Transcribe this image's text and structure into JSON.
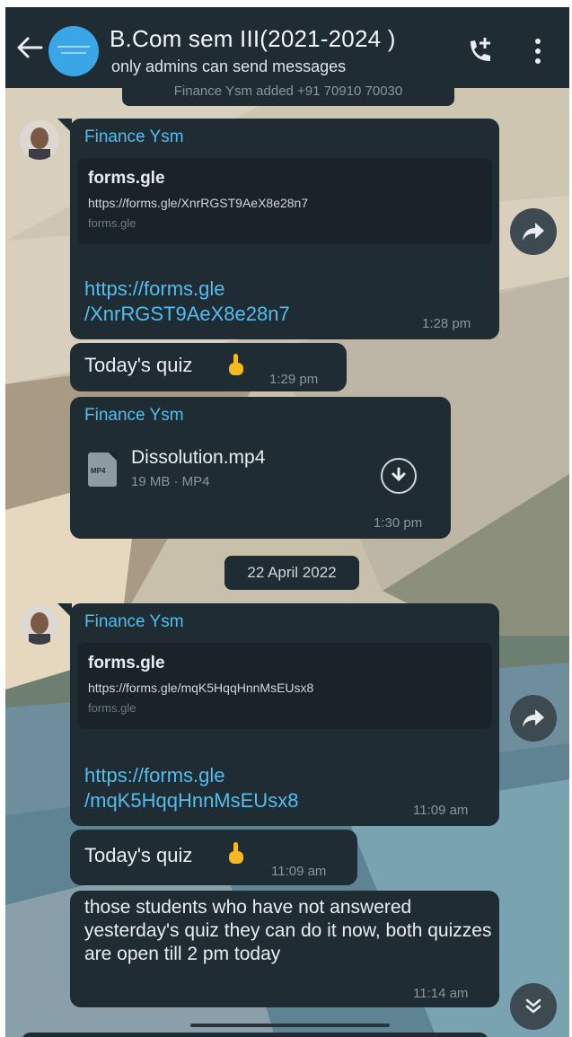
{
  "header": {
    "title": "B.Com sem III(2021-2024 )",
    "subtitle": "only admins can send messages",
    "back_icon": "arrow-left-icon",
    "call_icon": "add-call-icon",
    "menu_icon": "more-vert-icon"
  },
  "system_notice_partial": "Finance Ysm added +91 70910 70030",
  "messages": [
    {
      "sender": "Finance Ysm",
      "preview_title": "forms.gle",
      "preview_url": "https://forms.gle/XnrRGST9AeX8e28n7",
      "preview_domain": "forms.gle",
      "link_line1": "https://forms.gle",
      "link_line2": "/XnrRGST9AeX8e28n7",
      "time": "1:28 pm"
    },
    {
      "text": "Today's quiz",
      "time": "1:29 pm"
    },
    {
      "sender": "Finance Ysm",
      "file_name": "Dissolution.mp4",
      "file_meta": "19 MB · MP4",
      "file_icon_label": "MP4",
      "time": "1:30 pm"
    },
    {
      "sender": "Finance Ysm",
      "preview_title": "forms.gle",
      "preview_url": "https://forms.gle/mqK5HqqHnnMsEUsx8",
      "preview_domain": "forms.gle",
      "link_line1": "https://forms.gle",
      "link_line2": "/mqK5HqqHnnMsEUsx8",
      "time": "11:09 am"
    },
    {
      "text": "Today's quiz",
      "time": "11:09 am"
    },
    {
      "text": "those students who have not answered yesterday's quiz they can do it now, both quizzes are open till 2 pm today",
      "time": "11:14 am"
    }
  ],
  "date_divider": "22 April 2022",
  "colors": {
    "header_bg": "#1f2c34",
    "bubble_bg": "#1f2c34",
    "sender_name": "#53bdeb",
    "link": "#53bdeb",
    "timestamp": "#8696a0",
    "group_avatar": "#3aa6e8"
  }
}
